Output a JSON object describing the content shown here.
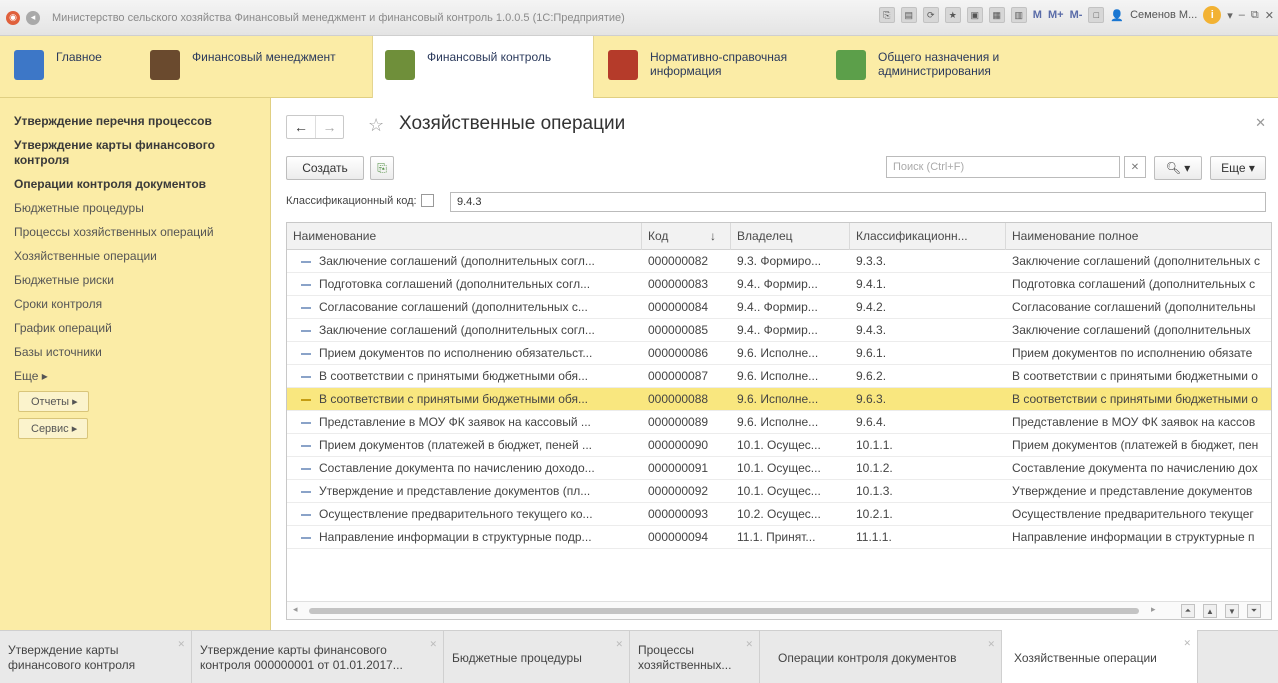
{
  "window": {
    "title": "Министерство сельского хозяйства Финансовый менеджмент и финансовый контроль 1.0.0.5 (1С:Предприятие)",
    "m_buttons": [
      "M",
      "M+",
      "M-"
    ],
    "user": "Семенов М...",
    "info": "i"
  },
  "sections": [
    {
      "label": "Главное",
      "color": "#3d77c7"
    },
    {
      "label": "Финансовый менеджмент",
      "color": "#6a4a2e"
    },
    {
      "label": "Финансовый контроль",
      "color": "#6f8f3a"
    },
    {
      "label": "Нормативно-справочная информация",
      "color": "#b53b2a"
    },
    {
      "label": "Общего назначения и администрирования",
      "color": "#5c9f4a"
    }
  ],
  "left_nav": {
    "bold_items": [
      "Утверждение перечня процессов",
      "Утверждение карты финансового контроля",
      "Операции контроля документов"
    ],
    "items": [
      "Бюджетные процедуры",
      "Процессы хозяйственных операций",
      "Хозяйственные операции",
      "Бюджетные риски",
      "Сроки контроля",
      "График операций",
      "Базы источники"
    ],
    "more": "Еще ▸",
    "buttons": [
      "Отчеты ▸",
      "Сервис ▸"
    ]
  },
  "form": {
    "title": "Хозяйственные операции",
    "create": "Создать",
    "search_placeholder": "Поиск (Ctrl+F)",
    "more": "Еще ▾",
    "classif_label": "Классификационный код:",
    "classif_value": "9.4.3"
  },
  "table": {
    "columns": [
      "Наименование",
      "Код",
      "Владелец",
      "Классификационн...",
      "Наименование полное"
    ],
    "sort_marker": "↓",
    "rows": [
      [
        "Заключение соглашений (дополнительных согл...",
        "000000082",
        "9.3. Формиро...",
        "9.3.3.",
        "Заключение соглашений (дополнительных с"
      ],
      [
        "Подготовка соглашений (дополнительных согл...",
        "000000083",
        "9.4.. Формир...",
        "9.4.1.",
        "Подготовка соглашений (дополнительных с"
      ],
      [
        "Согласование  соглашений (дополнительных с...",
        "000000084",
        "9.4.. Формир...",
        "9.4.2.",
        "Согласование  соглашений (дополнительны"
      ],
      [
        "Заключение  соглашений (дополнительных согл...",
        "000000085",
        "9.4.. Формир...",
        "9.4.3.",
        "Заключение  соглашений (дополнительных"
      ],
      [
        "Прием документов по исполнению обязательст...",
        "000000086",
        "9.6. Исполне...",
        "9.6.1.",
        "Прием документов по исполнению обязате"
      ],
      [
        "В соответствии с принятыми бюджетными обя...",
        "000000087",
        "9.6. Исполне...",
        "9.6.2.",
        "В соответствии с принятыми бюджетными о"
      ],
      [
        "В соответствии с принятыми бюджетными обя...",
        "000000088",
        "9.6. Исполне...",
        "9.6.3.",
        "В соответствии с принятыми бюджетными о"
      ],
      [
        "Представление в МОУ ФК заявок на кассовый ...",
        "000000089",
        "9.6. Исполне...",
        "9.6.4.",
        "Представление в МОУ ФК заявок на кассов"
      ],
      [
        "Прием документов (платежей в бюджет, пеней ...",
        "000000090",
        "10.1. Осущес...",
        "10.1.1.",
        "Прием документов (платежей в бюджет, пен"
      ],
      [
        "Составление документа по начислению доходо...",
        "000000091",
        "10.1. Осущес...",
        "10.1.2.",
        "Составление документа по начислению дох"
      ],
      [
        "Утверждение и представление документов (пл...",
        "000000092",
        "10.1. Осущес...",
        "10.1.3.",
        "Утверждение и представление документов"
      ],
      [
        "Осуществление предварительного текущего ко...",
        "000000093",
        "10.2. Осущес...",
        "10.2.1.",
        "Осуществление предварительного текущег"
      ],
      [
        "Направление информации в структурные подр...",
        "000000094",
        "11.1. Принят...",
        "11.1.1.",
        "Направление информации в структурные п"
      ]
    ],
    "selected_index": 6
  },
  "tabs": [
    {
      "label": "Утверждение карты финансового контроля"
    },
    {
      "label": "Утверждение карты финансового контроля 000000001 от 01.01.2017..."
    },
    {
      "label": "Бюджетные процедуры"
    },
    {
      "label": "Процессы хозяйственных..."
    },
    {
      "label": "Операции контроля документов"
    },
    {
      "label": "Хозяйственные операции"
    }
  ]
}
